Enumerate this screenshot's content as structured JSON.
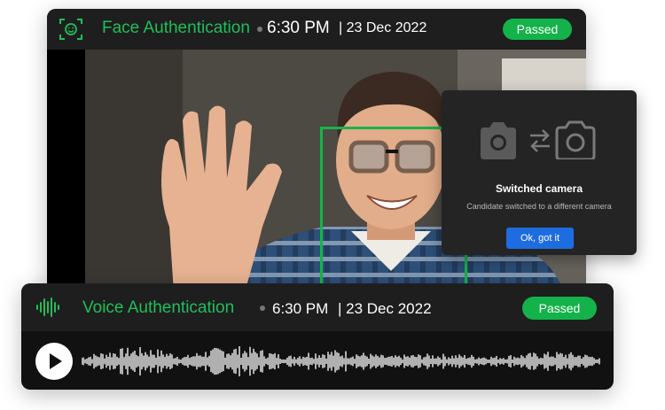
{
  "face": {
    "title": "Face Authentication",
    "time": "6:30 PM",
    "date": "| 23 Dec 2022",
    "status": "Passed"
  },
  "popup": {
    "title": "Switched camera",
    "subtitle": "Candidate switched to a different camera",
    "button": "Ok, got it"
  },
  "voice": {
    "title": "Voice Authentication",
    "time": "6:30 PM",
    "date": "| 23 Dec 2022",
    "status": "Passed"
  },
  "colors": {
    "accent_green": "#1fbf5a",
    "pill_green": "#14b24a",
    "button_blue": "#1e6de0"
  }
}
